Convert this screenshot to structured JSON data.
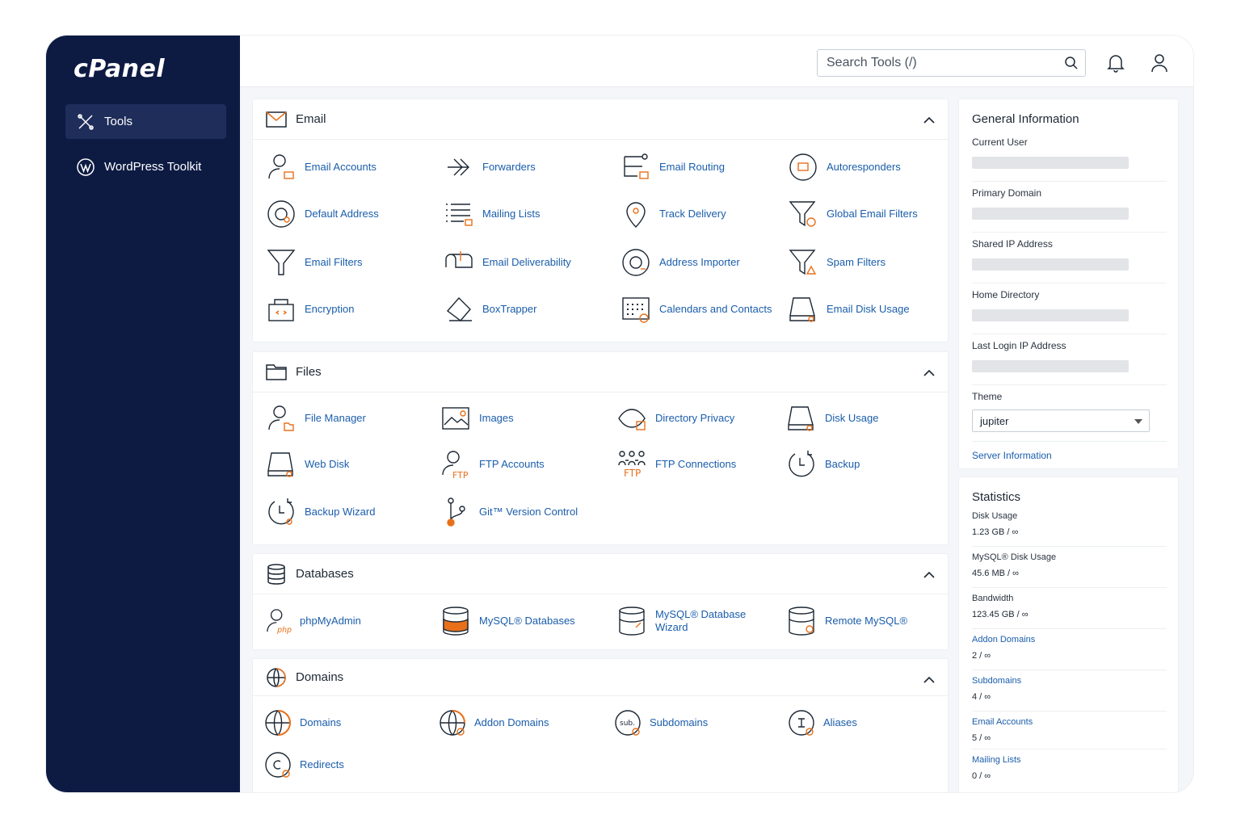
{
  "brand": {
    "logo_text": "cPanel"
  },
  "sidebar": {
    "items": [
      {
        "label": "Tools",
        "icon": "tools-icon",
        "active": true
      },
      {
        "label": "WordPress Toolkit",
        "icon": "wordpress-icon",
        "active": false
      }
    ]
  },
  "header": {
    "search_placeholder": "Search Tools (/)",
    "bell_icon": "bell-icon",
    "user_icon": "user-icon"
  },
  "sections": {
    "email": {
      "title": "Email",
      "tools": [
        "Email Accounts",
        "Forwarders",
        "Email Routing",
        "Autoresponders",
        "Default Address",
        "Mailing Lists",
        "Track Delivery",
        "Global Email Filters",
        "Email Filters",
        "Email Deliverability",
        "Address Importer",
        "Spam Filters",
        "Encryption",
        "BoxTrapper",
        "Calendars and Contacts",
        "Email Disk Usage"
      ]
    },
    "files": {
      "title": "Files",
      "tools": [
        "File Manager",
        "Images",
        "Directory Privacy",
        "Disk Usage",
        "Web Disk",
        "FTP Accounts",
        "FTP Connections",
        "Backup",
        "Backup Wizard",
        "Git™ Version Control"
      ]
    },
    "databases": {
      "title": "Databases",
      "tools": [
        "phpMyAdmin",
        "MySQL® Databases",
        "MySQL® Database Wizard",
        "Remote MySQL®"
      ]
    },
    "domains": {
      "title": "Domains",
      "tools": [
        "Domains",
        "Addon Domains",
        "Subdomains",
        "Aliases",
        "Redirects"
      ]
    }
  },
  "general_info": {
    "title": "General Information",
    "rows": [
      "Current User",
      "Primary Domain",
      "Shared IP Address",
      "Home Directory",
      "Last Login IP Address"
    ],
    "theme_label": "Theme",
    "theme_value": "jupiter",
    "server_info_link": "Server Information"
  },
  "statistics": {
    "title": "Statistics",
    "items": [
      {
        "label": "Disk Usage",
        "value": "1.23 GB / ∞",
        "link": false
      },
      {
        "label": "MySQL® Disk Usage",
        "value": "45.6 MB / ∞",
        "link": false
      },
      {
        "label": "Bandwidth",
        "value": "123.45 GB / ∞",
        "link": false
      },
      {
        "label": "Addon Domains",
        "value": "2 / ∞",
        "link": true
      },
      {
        "label": "Subdomains",
        "value": "4 / ∞",
        "link": true
      },
      {
        "label": "Email Accounts",
        "value": "5 / ∞",
        "link": true
      },
      {
        "label": "Mailing Lists",
        "value": "0 / ∞",
        "link": true
      }
    ]
  },
  "colors": {
    "sidebar": "#0d1b43",
    "accent": "#1a5dab",
    "icon_orange": "#e8701a"
  }
}
